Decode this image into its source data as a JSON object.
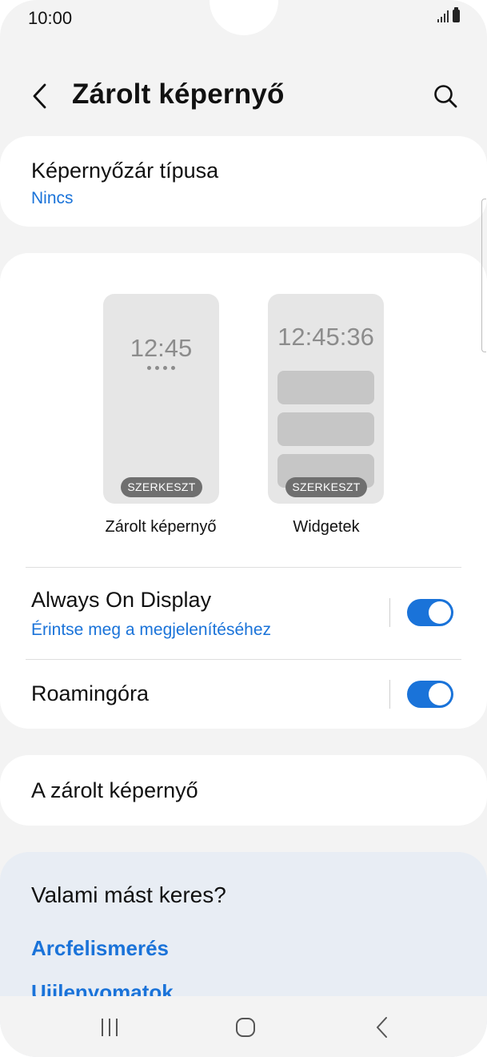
{
  "status_bar": {
    "time": "10:00"
  },
  "header": {
    "title": "Zárolt képernyő"
  },
  "lock_type": {
    "title": "Képernyőzár típusa",
    "value": "Nincs"
  },
  "previews": {
    "lock": {
      "clock": "12:45",
      "edit_label": "SZERKESZT",
      "caption": "Zárolt képernyő"
    },
    "widget": {
      "clock": "12:45:36",
      "edit_label": "SZERKESZT",
      "caption": "Widgetek"
    }
  },
  "always_on_display": {
    "title": "Always On Display",
    "subtitle": "Érintse meg a megjelenítéséhez",
    "enabled": true
  },
  "roaming_clock": {
    "title": "Roamingóra",
    "enabled": true
  },
  "lockscreen_section": {
    "title": "A zárolt képernyő"
  },
  "suggestions": {
    "title": "Valami mást keres?",
    "links": [
      "Arcfelismerés",
      "Ujjlenyomatok"
    ]
  },
  "colors": {
    "accent": "#1a73d9",
    "background": "#f3f3f3",
    "card": "#ffffff",
    "suggest_bg": "#e8edf4"
  },
  "icons": {
    "back": "chevron-left-icon",
    "search": "search-icon",
    "recents": "recents-icon",
    "home": "home-icon",
    "nav_back": "nav-back-icon"
  }
}
